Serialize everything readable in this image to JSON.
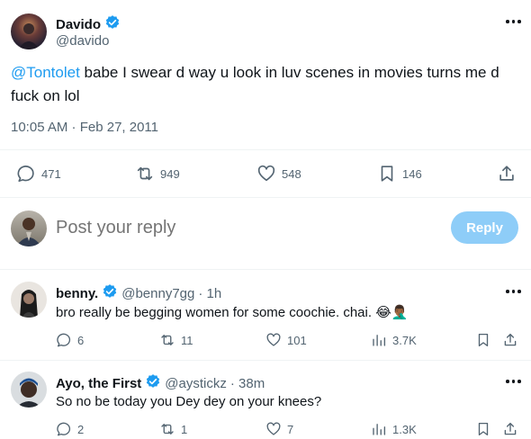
{
  "tweet": {
    "author_name": "Davido",
    "author_handle": "@davido",
    "mention": "@Tontolet",
    "text": " babe I swear d way u look in luv scenes in movies turns me d fuck on lol",
    "timestamp": "10:05 AM · Feb 27, 2011",
    "replies": "471",
    "retweets": "949",
    "likes": "548",
    "bookmarks": "146"
  },
  "reply_box": {
    "placeholder": "Post your reply",
    "button_label": "Reply"
  },
  "replies": [
    {
      "name": "benny.",
      "handle": "@benny7gg",
      "time": "· 1h",
      "text": "bro really be begging women for some coochie. chai. 😂🤦🏾‍♂️",
      "replies": "6",
      "retweets": "11",
      "likes": "101",
      "views": "3.7K"
    },
    {
      "name": "Ayo, the First",
      "handle": "@aystickz",
      "time": "· 38m",
      "text": "So no be today you Dey dey on your knees?",
      "replies": "2",
      "retweets": "1",
      "likes": "7",
      "views": "1.3K"
    }
  ],
  "colors": {
    "accent": "#1d9bf0",
    "reply_button_disabled": "#8ecdf8",
    "muted": "#536471",
    "divider": "#eff3f4"
  }
}
